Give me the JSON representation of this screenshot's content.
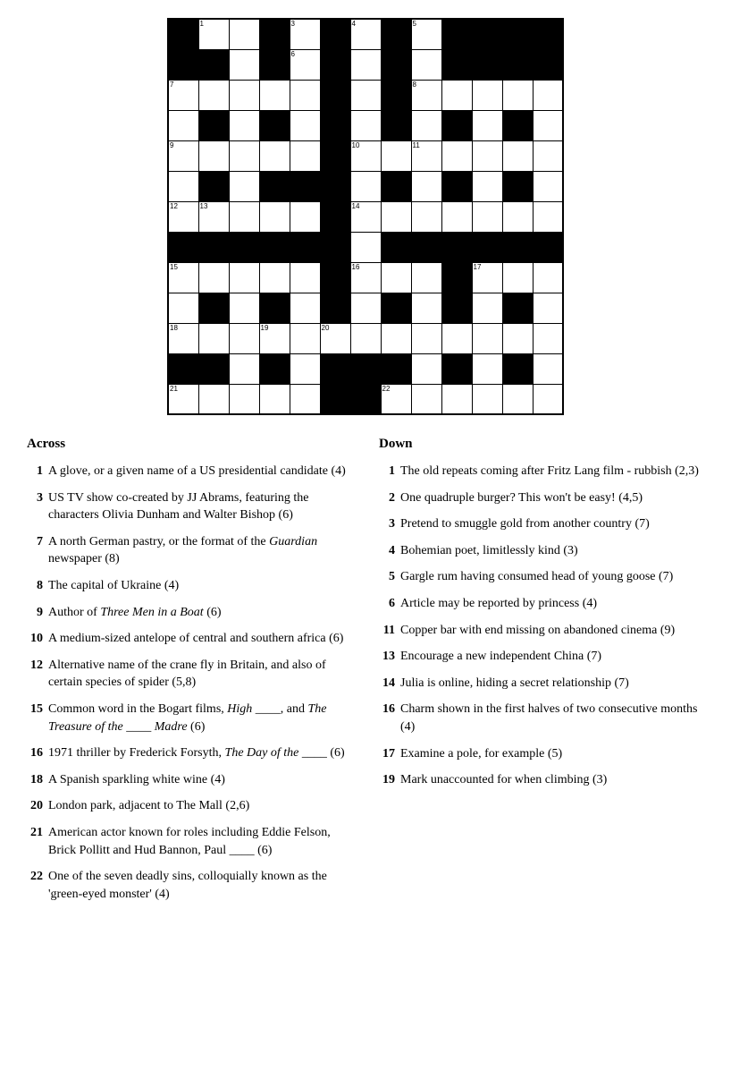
{
  "grid": {
    "rows": 13,
    "cols": 13,
    "cells": [
      [
        "black",
        "white1",
        "white2",
        "black",
        "white3",
        "black",
        "white4",
        "black",
        "white5",
        "black",
        "black",
        "black",
        "black"
      ],
      [
        "black",
        "black",
        "white",
        "black",
        "white6",
        "black",
        "white",
        "black",
        "white",
        "black",
        "black",
        "black",
        "black"
      ],
      [
        "white7",
        "white",
        "white",
        "white",
        "white",
        "black",
        "white",
        "black",
        "white8",
        "white",
        "white",
        "white",
        "white"
      ],
      [
        "white",
        "black",
        "white",
        "black",
        "white",
        "black",
        "white",
        "black",
        "white",
        "black",
        "white",
        "black",
        "white"
      ],
      [
        "white9",
        "white",
        "white",
        "white",
        "white",
        "black",
        "white10",
        "white",
        "white11",
        "white",
        "white",
        "white",
        "white"
      ],
      [
        "white",
        "black",
        "white",
        "black",
        "black",
        "black",
        "white",
        "black",
        "white",
        "black",
        "white",
        "black",
        "white"
      ],
      [
        "white12",
        "white13",
        "white",
        "white",
        "white",
        "black",
        "white14",
        "white",
        "white",
        "white",
        "white",
        "white",
        "white"
      ],
      [
        "black",
        "black",
        "black",
        "black",
        "black",
        "black",
        "white",
        "black",
        "black",
        "black",
        "black",
        "black",
        "black"
      ],
      [
        "white15",
        "white",
        "white",
        "white",
        "white",
        "black",
        "white16",
        "white",
        "white",
        "black",
        "white17",
        "white",
        "white"
      ],
      [
        "white",
        "black",
        "white",
        "black",
        "white",
        "black",
        "white",
        "black",
        "white",
        "black",
        "white",
        "black",
        "white"
      ],
      [
        "white18",
        "white",
        "white",
        "white19",
        "white",
        "white20",
        "white",
        "white",
        "white",
        "white",
        "white",
        "white",
        "white"
      ],
      [
        "black",
        "black",
        "white",
        "black",
        "white",
        "black",
        "black",
        "black",
        "white",
        "black",
        "white",
        "black",
        "white"
      ],
      [
        "white21",
        "white",
        "white",
        "white",
        "white",
        "black",
        "black",
        "white22",
        "white",
        "white",
        "white",
        "white",
        "white"
      ]
    ],
    "numbers": {
      "0,1": "1",
      "0,4": "3",
      "0,6": "4",
      "0,8": "5",
      "1,4": "6",
      "2,0": "7",
      "2,8": "8",
      "4,0": "9",
      "4,6": "10",
      "4,8": "11",
      "6,0": "12",
      "6,1": "13",
      "6,6": "14",
      "8,0": "15",
      "8,6": "16",
      "8,10": "17",
      "10,0": "18",
      "10,3": "19",
      "10,5": "20",
      "12,0": "21",
      "12,7": "22"
    }
  },
  "across_heading": "Across",
  "down_heading": "Down",
  "across_clues": [
    {
      "number": "1",
      "text": "A glove, or a given name of a US presidential candidate (4)"
    },
    {
      "number": "3",
      "text": "US TV show co-created by JJ Abrams, featuring the characters Olivia Dunham and Walter Bishop (6)"
    },
    {
      "number": "7",
      "text": "A north German pastry, or the format of the Guardian newspaper (8)"
    },
    {
      "number": "8",
      "text": "The capital of Ukraine (4)"
    },
    {
      "number": "9",
      "text": "Author of Three Men in a Boat (6)"
    },
    {
      "number": "10",
      "text": "A medium-sized antelope of central and southern africa (6)"
    },
    {
      "number": "12",
      "text": "Alternative name of the crane fly in Britain, and also of certain species of spider (5,8)"
    },
    {
      "number": "15",
      "text": "Common word in the Bogart films, High ____, and The Treasure of the ____ Madre (6)"
    },
    {
      "number": "16",
      "text": "1971 thriller by Frederick Forsyth, The Day of the ____ (6)"
    },
    {
      "number": "18",
      "text": "A Spanish sparkling white wine (4)"
    },
    {
      "number": "20",
      "text": "London park, adjacent to The Mall (2,6)"
    },
    {
      "number": "21",
      "text": "American actor known for roles including Eddie Felson, Brick Pollitt and Hud Bannon, Paul ____ (6)"
    },
    {
      "number": "22",
      "text": "One of the seven deadly sins, colloquially known as the 'green-eyed monster' (4)"
    }
  ],
  "down_clues": [
    {
      "number": "1",
      "text": "The old repeats coming after Fritz Lang film - rubbish (2,3)"
    },
    {
      "number": "2",
      "text": "One quadruple burger? This won't be easy! (4,5)"
    },
    {
      "number": "3",
      "text": "Pretend to smuggle gold from another country (7)"
    },
    {
      "number": "4",
      "text": "Bohemian poet, limitlessly kind (3)"
    },
    {
      "number": "5",
      "text": "Gargle rum having consumed head of young goose (7)"
    },
    {
      "number": "6",
      "text": "Article may be reported by princess (4)"
    },
    {
      "number": "11",
      "text": "Copper bar with end missing on abandoned cinema (9)"
    },
    {
      "number": "13",
      "text": "Encourage a new independent China (7)"
    },
    {
      "number": "14",
      "text": "Julia is online, hiding a secret relationship (7)"
    },
    {
      "number": "16",
      "text": "Charm shown in the first halves of two consecutive months (4)"
    },
    {
      "number": "17",
      "text": "Examine a pole, for example (5)"
    },
    {
      "number": "19",
      "text": "Mark unaccounted for when climbing (3)"
    }
  ]
}
